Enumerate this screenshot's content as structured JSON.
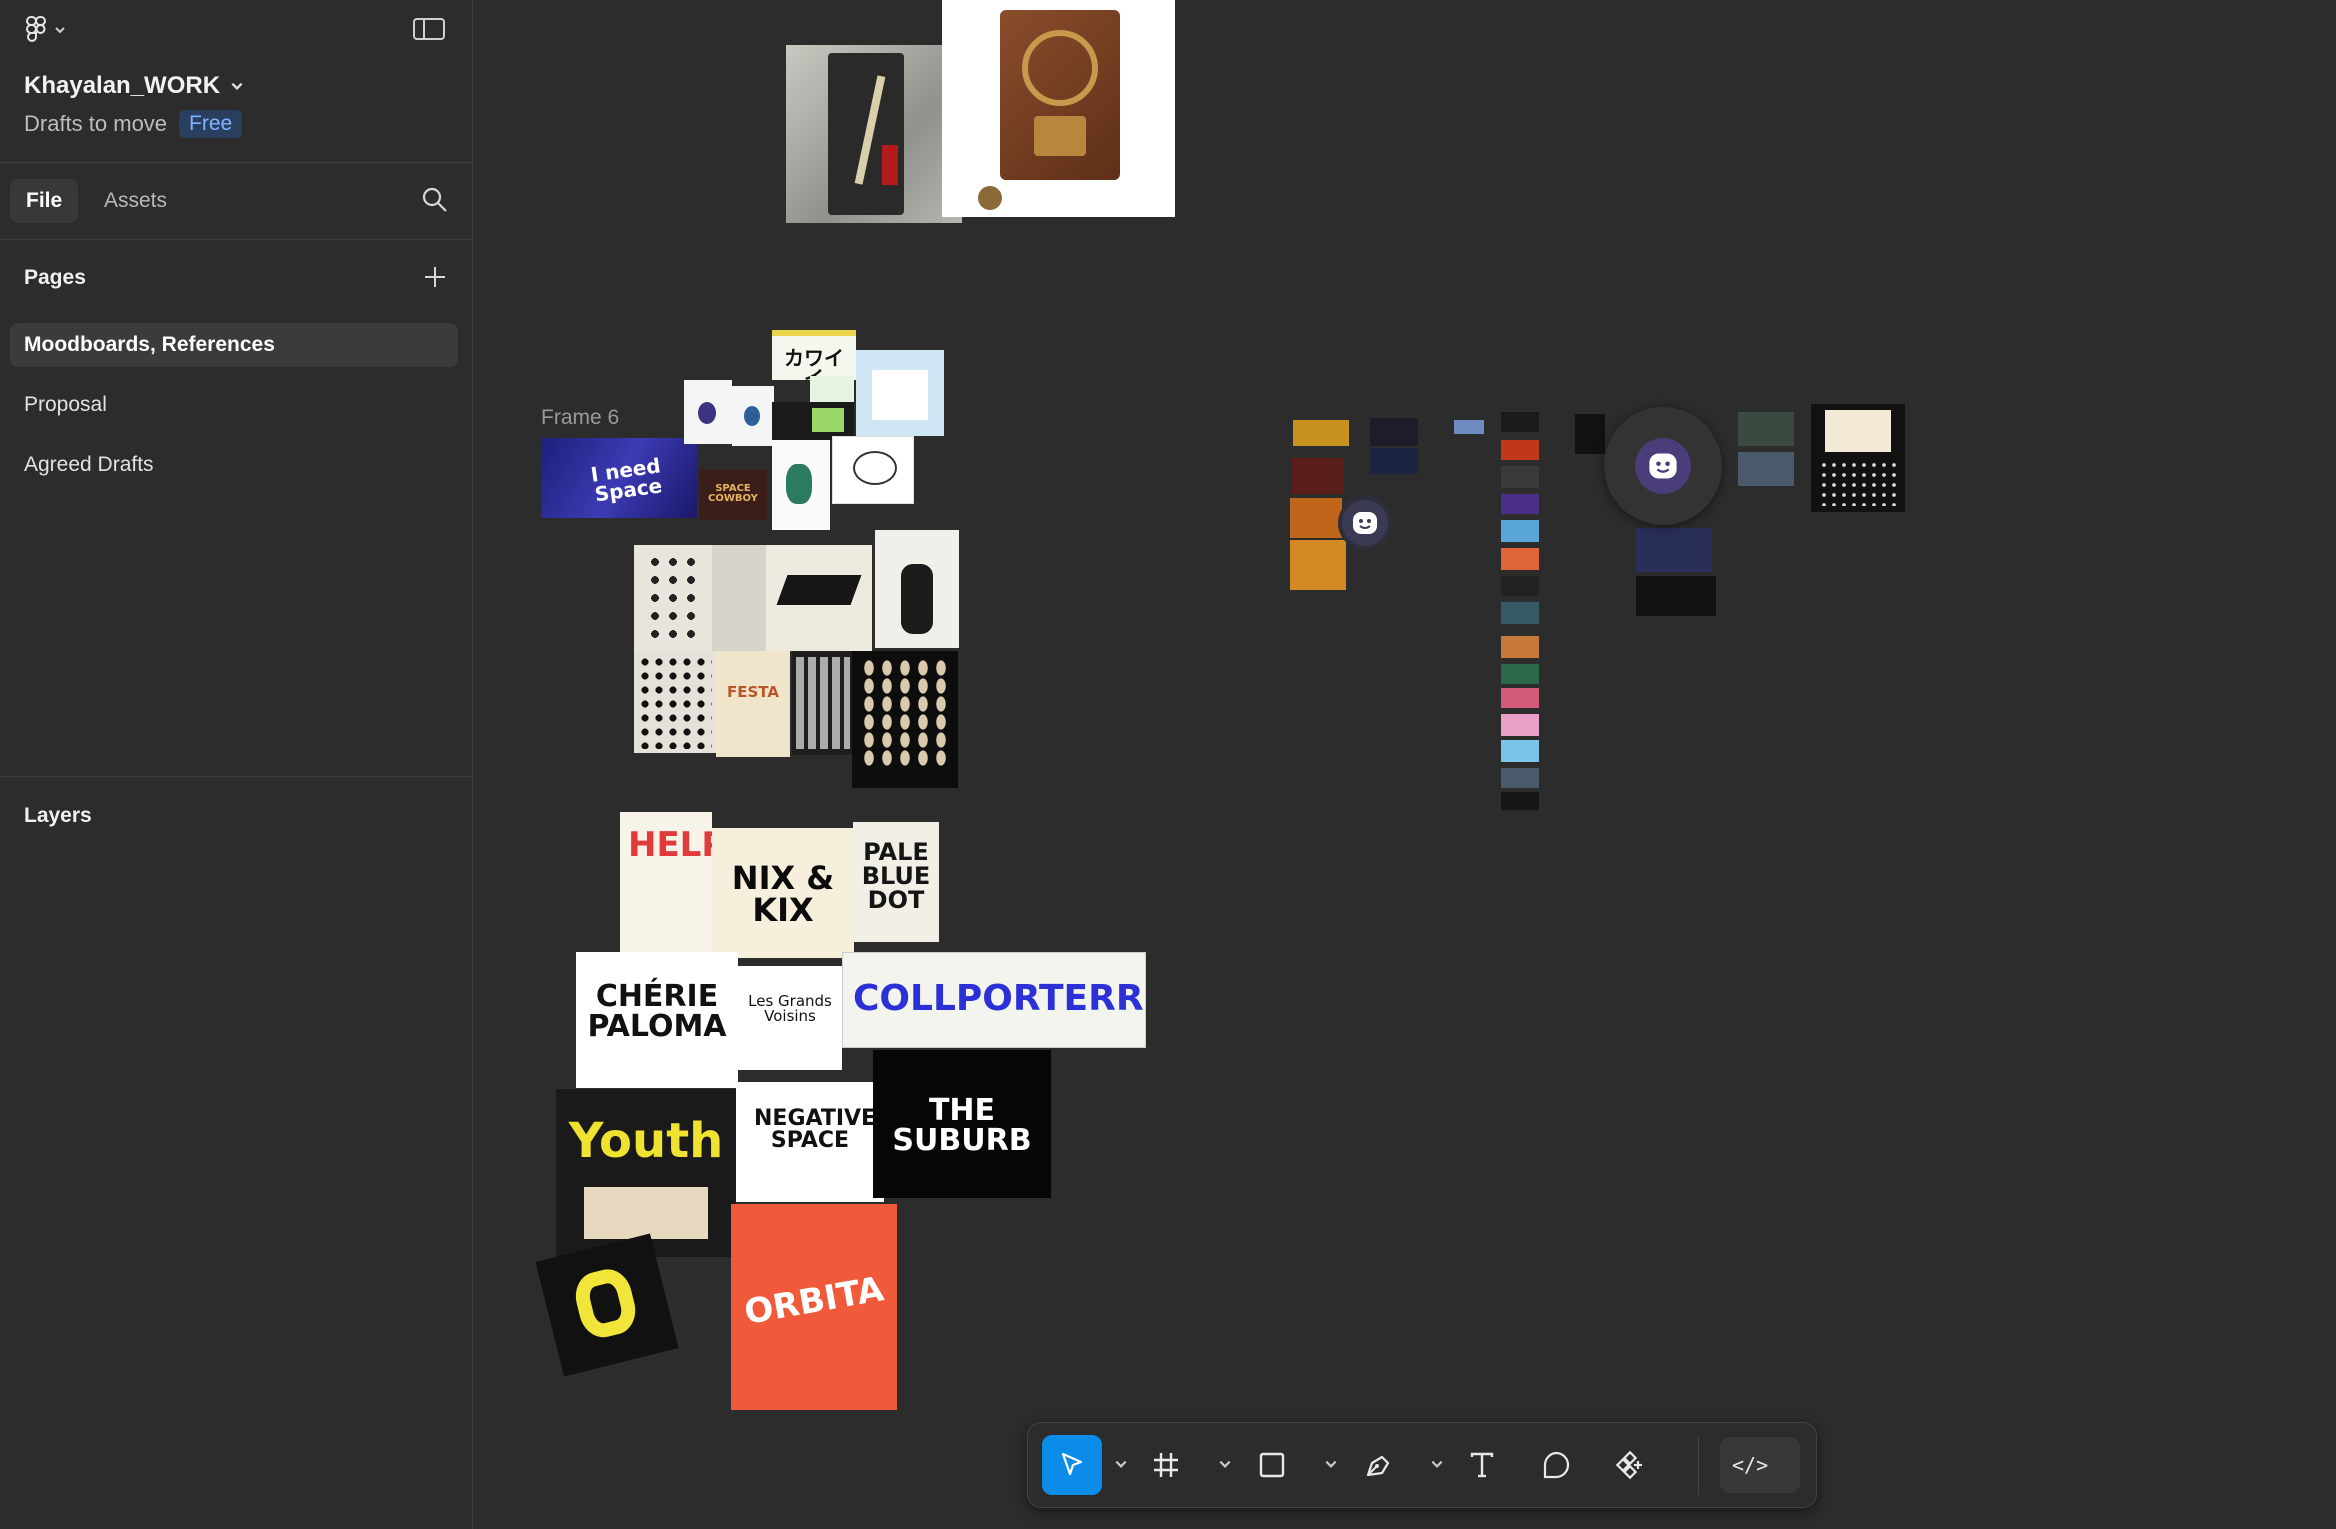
{
  "sidebar": {
    "file_name": "Khayalan_WORK",
    "project": "Drafts to move",
    "plan_badge": "Free",
    "tabs": [
      {
        "label": "File",
        "active": true
      },
      {
        "label": "Assets",
        "active": false
      }
    ],
    "pages_title": "Pages",
    "pages": [
      {
        "label": "Moodboards, References",
        "selected": true
      },
      {
        "label": "Proposal",
        "selected": false
      },
      {
        "label": "Agreed Drafts",
        "selected": false
      }
    ],
    "layers_title": "Layers"
  },
  "canvas": {
    "frame_label": "Frame 6",
    "poster_texts": {
      "katakana": "カワイイ",
      "need_space": "I need Space",
      "space_cowboy": "SPACE COWBOY",
      "festa": "FESTA",
      "help": "HELP",
      "nixkix": "NIX & KIX",
      "pale_blue_dot": "PALE BLUE DOT",
      "cherie_paloma": "CHÉRIE PALOMA",
      "grands_voisins": "Les Grands Voisins",
      "colporterre": "COLLPORTERRE",
      "youth": "Youth",
      "negative_space": "NEGATIVE SPACE",
      "the_suburb": "THE SUBURB",
      "orbita": "ORBITA"
    }
  },
  "toolbar": {
    "tools": [
      "move-tool",
      "frame-tool",
      "shape-tool",
      "pen-tool",
      "text-tool",
      "comment-tool",
      "actions-tool"
    ],
    "active_tool": "move-tool",
    "dev_mode_label": "</>"
  },
  "colors": {
    "accent": "#0c8ce9",
    "canvas_bg": "#2c2c2c",
    "badge_bg": "#2a3e60",
    "badge_text": "#7fb4ff"
  }
}
